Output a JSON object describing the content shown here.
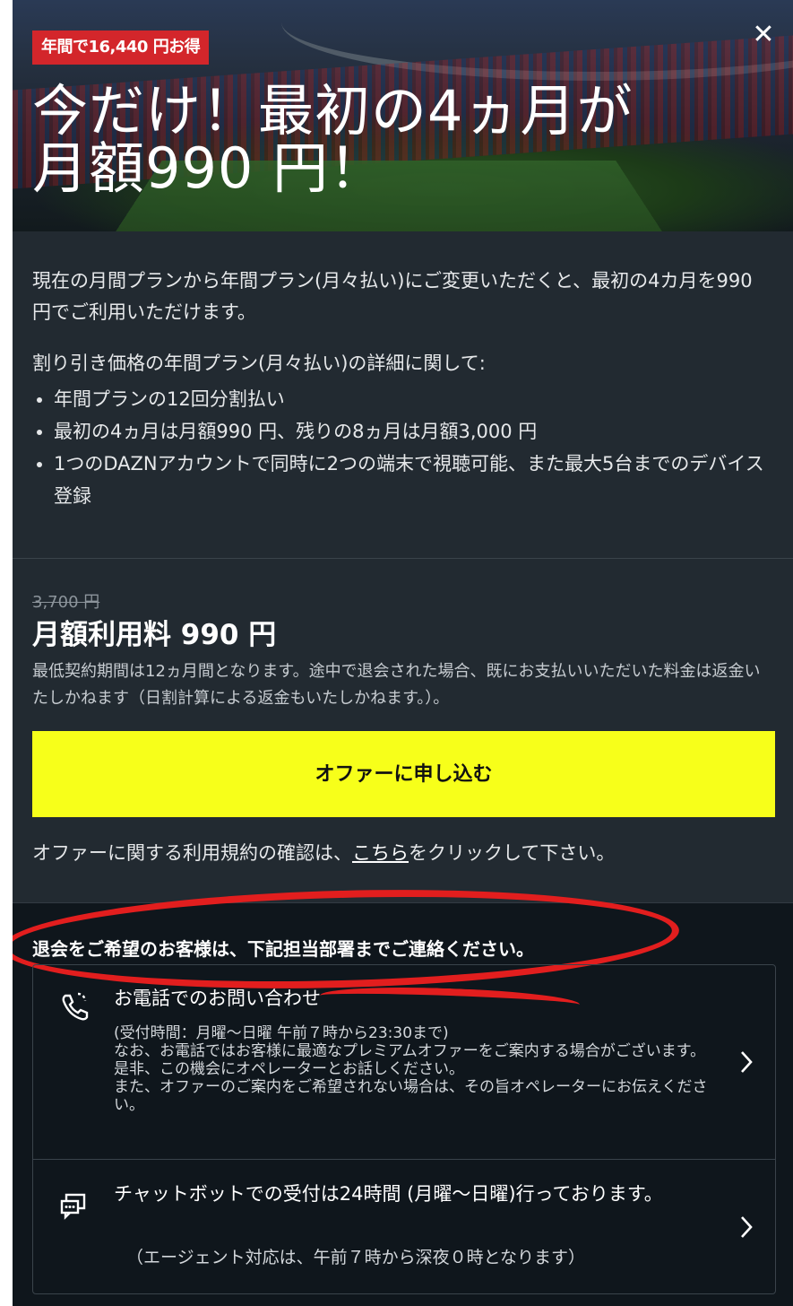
{
  "hero": {
    "badge": "年間で16,440 円お得",
    "title_line1": "今だけ！最初の4ヵ月が",
    "title_line2": "月額990 円！",
    "close_label": "✕"
  },
  "description": {
    "paragraph1": "現在の月間プランから年間プラン(月々払い)にご変更いただくと、最初の4カ月を990 円でご利用いただけます。",
    "paragraph2": "割り引き価格の年間プラン(月々払い)の詳細に関して:",
    "bullets": [
      "年間プランの12回分割払い",
      "最初の4ヵ月は月額990 円、残りの8ヵ月は月額3,000 円",
      "1つのDAZNアカウントで同時に2つの端末で視聴可能、また最大5台までのデバイス登録"
    ]
  },
  "pricing": {
    "old_price": "3,700 円",
    "main_price": "月額利用料 990 円",
    "note": "最低契約期間は12ヵ月間となります。途中で退会された場合、既にお支払いいただいた料金は返金いたしかねます（日割計算による返金もいたしかねます。）。"
  },
  "cta": {
    "label": "オファーに申し込む"
  },
  "terms": {
    "prefix": "オファーに関する利用規約の確認は、",
    "link": "こちら",
    "suffix": "をクリックして下さい。"
  },
  "contact": {
    "heading": "退会をご希望のお客様は、下記担当部署までご連絡ください。",
    "phone": {
      "title": "お電話でのお問い合わせ",
      "hours": "(受付時間：月曜～日曜 午前７時から23:30まで)",
      "body": "なお、お電話ではお客様に最適なプレミアムオファーをご案内する場合がございます。\n是非、この機会にオペレーターとお話しください。\nまた、オファーのご案内をご希望されない場合は、その旨オペレーターにお伝えください。",
      "icon": "phone-icon"
    },
    "chat": {
      "title": "チャットボットでの受付は24時間 (月曜～日曜)行っております。",
      "body": "（エージェント対応は、午前７時から深夜０時となります）",
      "icon": "chat-icon"
    }
  },
  "colors": {
    "modal_bg": "#222a31",
    "lower_bg": "#0f161c",
    "cta_bg": "#f7ff1a",
    "badge_bg": "#d3262b",
    "annotation": "#e21e1e"
  }
}
